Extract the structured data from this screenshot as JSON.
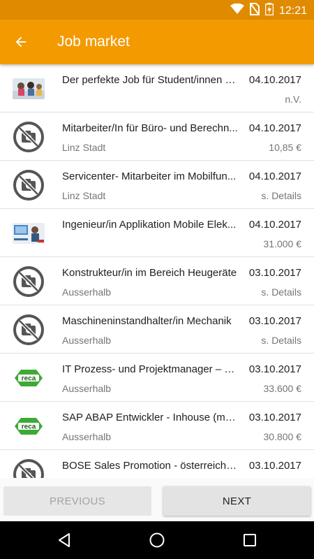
{
  "status_bar": {
    "time": "12:21"
  },
  "app_bar": {
    "title": "Job market"
  },
  "jobs": [
    {
      "title": "Der perfekte Job für Student/innen u...",
      "date": "04.10.2017",
      "location": "",
      "salary": "n.V.",
      "thumb": "photo-students"
    },
    {
      "title": "Mitarbeiter/In für Büro- und Berechn...",
      "date": "04.10.2017",
      "location": "Linz Stadt",
      "salary": "10,85 €",
      "thumb": "no-image"
    },
    {
      "title": "Servicenter- Mitarbeiter im Mobilfun...",
      "date": "04.10.2017",
      "location": "Linz Stadt",
      "salary": "s. Details",
      "thumb": "no-image"
    },
    {
      "title": "Ingenieur/in Applikation Mobile Elek...",
      "date": "04.10.2017",
      "location": "",
      "salary": "31.000 €",
      "thumb": "photo-engineer"
    },
    {
      "title": "Konstrukteur/in im Bereich Heugeräte",
      "date": "03.10.2017",
      "location": "Ausserhalb",
      "salary": "s. Details",
      "thumb": "no-image"
    },
    {
      "title": "Maschineninstandhalter/in Mechanik",
      "date": "03.10.2017",
      "location": "Ausserhalb",
      "salary": "s. Details",
      "thumb": "no-image"
    },
    {
      "title": "IT Prozess- und Projektmanager – L...",
      "date": "03.10.2017",
      "location": "Ausserhalb",
      "salary": "33.600 €",
      "thumb": "reca-logo",
      "logo_text": "reca"
    },
    {
      "title": "SAP ABAP Entwickler - Inhouse (m/w)",
      "date": "03.10.2017",
      "location": "Ausserhalb",
      "salary": "30.800 €",
      "thumb": "reca-logo",
      "logo_text": "reca"
    },
    {
      "title": "BOSE Sales Promotion - österreichw...",
      "date": "03.10.2017",
      "location": "",
      "salary": "",
      "thumb": "no-image"
    }
  ],
  "buttons": {
    "previous": "PREVIOUS",
    "next": "NEXT"
  },
  "colors": {
    "status_bar": "#e08a00",
    "app_bar": "#f39a00",
    "logo_green": "#3daa35"
  }
}
